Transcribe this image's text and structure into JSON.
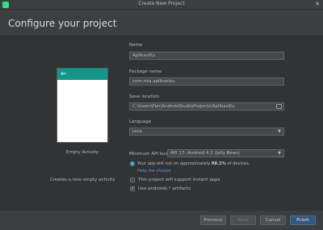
{
  "window": {
    "title": "Create New Project"
  },
  "header": {
    "title": "Configure your project"
  },
  "template": {
    "name": "Empty Activity",
    "description": "Creates a new empty activity"
  },
  "form": {
    "name_label": "Name",
    "name_value": "AplikasiKu",
    "package_label": "Package name",
    "package_value": "com.risa.aplikasiku",
    "location_label": "Save location",
    "location_value": "C:\\Users\\Fen\\AndroidStudioProjects\\AplikasiKu",
    "language_label": "Language",
    "language_value": "Java",
    "min_api_label": "Minimum API level",
    "min_api_value": "API 17: Android 4.2 (Jelly Bean)",
    "info_prefix": "Your app will run on approximately ",
    "info_percent": "98.1%",
    "info_suffix": " of devices.",
    "help_link": "Help me choose",
    "instant_apps_label": "This project will support instant apps",
    "instant_apps_checked": false,
    "androidx_label": "Use androidx.* artifacts",
    "androidx_checked": true
  },
  "footer": {
    "previous": "Previous",
    "next": "Next",
    "cancel": "Cancel",
    "finish": "Finish"
  },
  "colors": {
    "accent": "#14968a",
    "primary_button": "#365880",
    "link": "#589df6",
    "background": "#313335"
  }
}
